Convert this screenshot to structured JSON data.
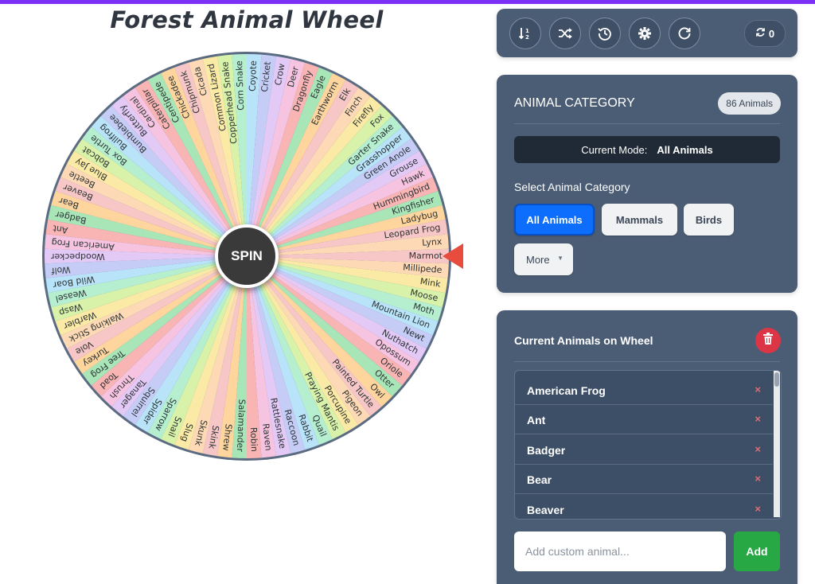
{
  "title": "Forest Animal Wheel",
  "wheel": {
    "spin_label": "SPIN",
    "segments": [
      "Marmot",
      "Millipede",
      "Mink",
      "Moose",
      "Moth",
      "Mountain Lion",
      "Newt",
      "Nuthatch",
      "Opossum",
      "Oriole",
      "Otter",
      "Owl",
      "Painted Turtle",
      "Pigeon",
      "Porcupine",
      "Praying Mantis",
      "Quail",
      "Rabbit",
      "Raccoon",
      "Rattlesnake",
      "Raven",
      "Robin",
      "Salamander",
      "Shrew",
      "Skink",
      "Skunk",
      "Slug",
      "Snail",
      "Sparrow",
      "Spider",
      "Squirrel",
      "Tanager",
      "Thrush",
      "Toad",
      "Tree Frog",
      "Turkey",
      "Vole",
      "Walking Stick",
      "Warbler",
      "Wasp",
      "Weasel",
      "Wild Boar",
      "Wolf",
      "Woodpecker",
      "American Frog",
      "Ant",
      "Badger",
      "Bear",
      "Beaver",
      "Beetle",
      "Blue Jay",
      "Bobcat",
      "Box Turtle",
      "Bullfrog",
      "Bumblebee",
      "Butterfly",
      "Cardinal",
      "Caterpillar",
      "Centipede",
      "Chickadee",
      "Chipmunk",
      "Cicada",
      "Common Lizard",
      "Copperhead Snake",
      "Corn Snake",
      "Coyote",
      "Cricket",
      "Crow",
      "Deer",
      "Dragonfly",
      "Eagle",
      "Earthworm",
      "Elk",
      "Finch",
      "Firefly",
      "Fox",
      "Garter Snake",
      "Grasshopper",
      "Green Anole",
      "Grouse",
      "Hawk",
      "Hummingbird",
      "Kingfisher",
      "Ladybug",
      "Leopard Frog",
      "Lynx"
    ],
    "palette": [
      "#f7c6c6",
      "#fdd9b5",
      "#fbeaa5",
      "#d8f2a9",
      "#b6efd0",
      "#b8e3f8",
      "#c5cdf7",
      "#e3c9f6",
      "#f6c4e0",
      "#f9b4b4",
      "#a8e6b8",
      "#ffd59e"
    ]
  },
  "toolbar": {
    "sort_icon": "sort-numeric-icon",
    "shuffle_icon": "shuffle-icon",
    "history_icon": "history-icon",
    "settings_icon": "gear-icon",
    "reset_icon": "redo-icon",
    "spin_count": "0"
  },
  "category": {
    "title": "ANIMAL CATEGORY",
    "count_badge": "86 Animals",
    "mode_label": "Current Mode:",
    "mode_value": "All Animals",
    "select_label": "Select Animal Category",
    "buttons": {
      "all": "All Animals",
      "mammals": "Mammals",
      "birds": "Birds",
      "more": "More"
    }
  },
  "animals": {
    "title": "Current Animals on Wheel",
    "items": [
      {
        "name": "American Frog"
      },
      {
        "name": "Ant"
      },
      {
        "name": "Badger"
      },
      {
        "name": "Bear"
      },
      {
        "name": "Beaver"
      }
    ],
    "remove_symbol": "×"
  },
  "add": {
    "placeholder": "Add custom animal...",
    "button_label": "Add"
  },
  "colors": {
    "panel": "#4b5d75",
    "accent": "#0d6efd",
    "add": "#28a745",
    "delete": "#dc3545",
    "pointer": "#e74c3c",
    "topbar": "#7b2ff7"
  }
}
